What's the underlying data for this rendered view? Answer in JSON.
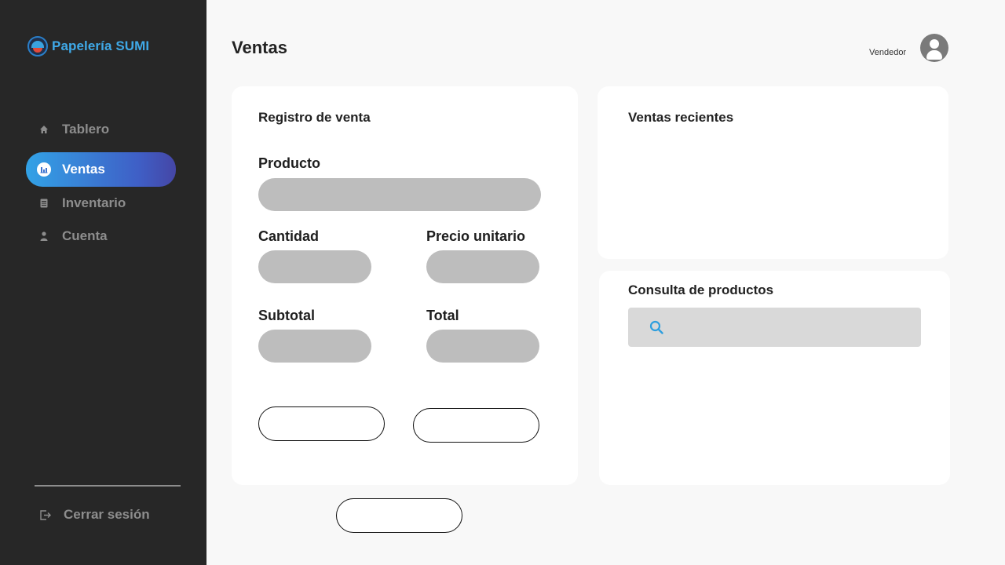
{
  "brand": {
    "name": "Papelería SUMI"
  },
  "sidebar": {
    "items": [
      {
        "label": "Tablero",
        "icon": "home-icon",
        "active": false
      },
      {
        "label": "Ventas",
        "icon": "sales-chart-icon",
        "active": true
      },
      {
        "label": "Inventario",
        "icon": "inventory-icon",
        "active": false
      },
      {
        "label": "Cuenta",
        "icon": "user-icon",
        "active": false
      }
    ],
    "logout_label": "Cerrar sesión"
  },
  "header": {
    "title": "Ventas",
    "user_role": "Vendedor"
  },
  "sale_form": {
    "title": "Registro de venta",
    "product_label": "Producto",
    "product_value": "",
    "quantity_label": "Cantidad",
    "quantity_value": "",
    "unit_price_label": "Precio unitario",
    "unit_price_value": "",
    "subtotal_label": "Subtotal",
    "subtotal_value": "",
    "total_label": "Total",
    "total_value": "",
    "button_1_label": "",
    "button_2_label": "",
    "button_3_label": ""
  },
  "recent_sales": {
    "title": "Ventas recientes"
  },
  "product_lookup": {
    "title": "Consulta de productos",
    "search_value": ""
  },
  "colors": {
    "sidebar_bg": "#272727",
    "accent_start": "#32a2e6",
    "accent_end": "#4546a6",
    "brand": "#3fa9e8",
    "input_bg": "#bdbdbd",
    "search_bg": "#d9d9d9"
  }
}
